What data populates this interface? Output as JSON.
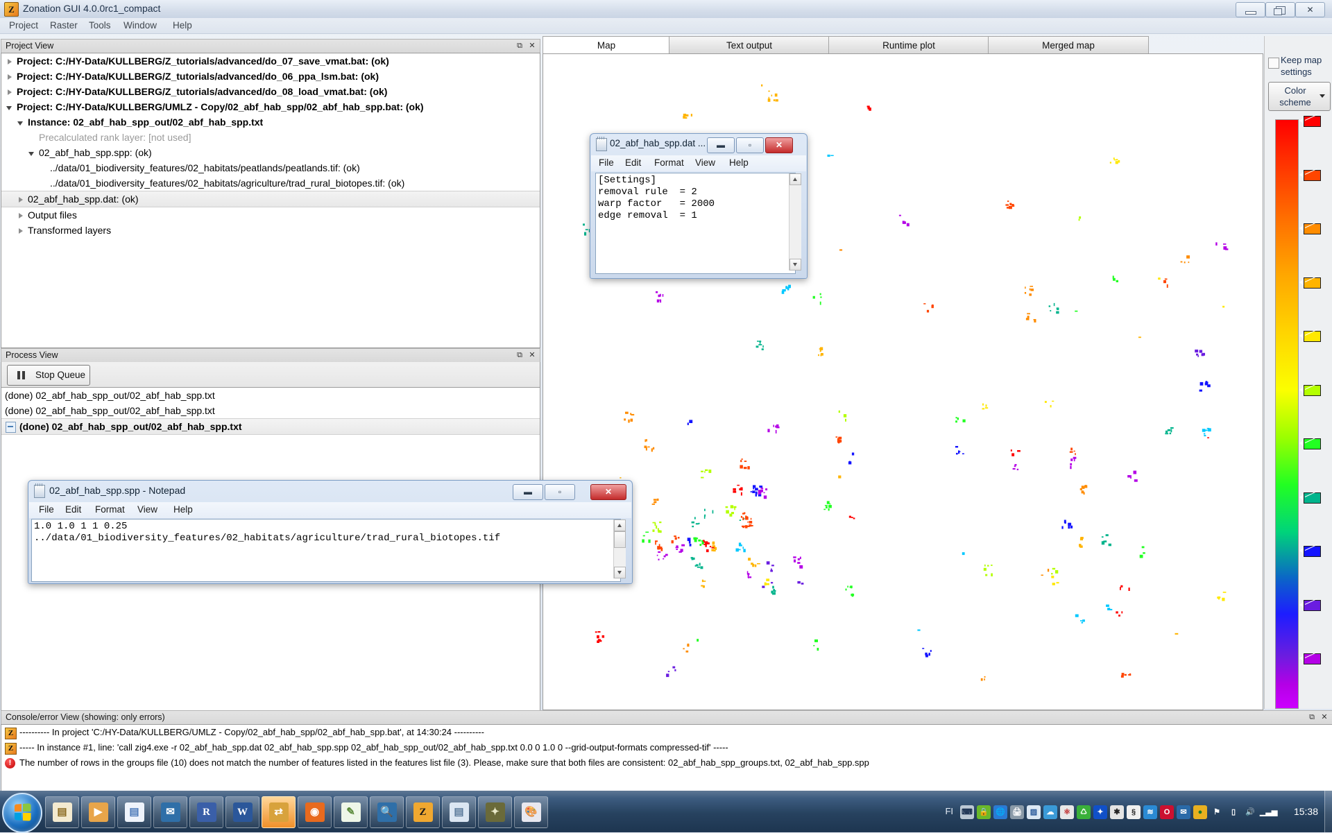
{
  "window": {
    "title": "Zonation GUI 4.0.0rc1_compact",
    "app_icon": "Z",
    "buttons": {
      "minimize": "minimize-icon",
      "maximize": "restore-icon",
      "close": "close-icon"
    }
  },
  "menubar": {
    "items": [
      "Project",
      "Raster",
      "Tools",
      "Window",
      "Help"
    ]
  },
  "project_view": {
    "title": "Project View",
    "float_label": "⧉",
    "close_label": "✕",
    "tree": [
      {
        "indent": 0,
        "twisty": "closed",
        "bold": true,
        "grey": false,
        "selected": false,
        "text": "Project: C:/HY-Data/KULLBERG/Z_tutorials/advanced/do_07_save_vmat.bat: (ok)"
      },
      {
        "indent": 0,
        "twisty": "closed",
        "bold": true,
        "grey": false,
        "selected": false,
        "text": "Project: C:/HY-Data/KULLBERG/Z_tutorials/advanced/do_06_ppa_lsm.bat: (ok)"
      },
      {
        "indent": 0,
        "twisty": "closed",
        "bold": true,
        "grey": false,
        "selected": false,
        "text": "Project: C:/HY-Data/KULLBERG/Z_tutorials/advanced/do_08_load_vmat.bat: (ok)"
      },
      {
        "indent": 0,
        "twisty": "open",
        "bold": true,
        "grey": false,
        "selected": false,
        "text": "Project: C:/HY-Data/KULLBERG/UMLZ - Copy/02_abf_hab_spp/02_abf_hab_spp.bat: (ok)"
      },
      {
        "indent": 1,
        "twisty": "open",
        "bold": true,
        "grey": false,
        "selected": false,
        "text": "Instance: 02_abf_hab_spp_out/02_abf_hab_spp.txt"
      },
      {
        "indent": 2,
        "twisty": "none",
        "bold": false,
        "grey": true,
        "selected": false,
        "text": "Precalculated rank layer: [not used]"
      },
      {
        "indent": 2,
        "twisty": "open",
        "bold": false,
        "grey": false,
        "selected": false,
        "text": "02_abf_hab_spp.spp: (ok)"
      },
      {
        "indent": 3,
        "twisty": "none",
        "bold": false,
        "grey": false,
        "selected": false,
        "text": "../data/01_biodiversity_features/02_habitats/peatlands/peatlands.tif: (ok)"
      },
      {
        "indent": 3,
        "twisty": "none",
        "bold": false,
        "grey": false,
        "selected": false,
        "text": "../data/01_biodiversity_features/02_habitats/agriculture/trad_rural_biotopes.tif: (ok)"
      },
      {
        "indent": 1,
        "twisty": "closed",
        "bold": false,
        "grey": false,
        "selected": true,
        "text": "02_abf_hab_spp.dat: (ok)"
      },
      {
        "indent": 1,
        "twisty": "closed",
        "bold": false,
        "grey": false,
        "selected": false,
        "text": "Output files"
      },
      {
        "indent": 1,
        "twisty": "closed",
        "bold": false,
        "grey": false,
        "selected": false,
        "text": "Transformed layers"
      }
    ]
  },
  "process_view": {
    "title": "Process View",
    "float_label": "⧉",
    "close_label": "✕",
    "stop_queue_label": "Stop Queue",
    "rows": [
      {
        "text": "(done) 02_abf_hab_spp_out/02_abf_hab_spp.txt",
        "selected": false
      },
      {
        "text": "(done) 02_abf_hab_spp_out/02_abf_hab_spp.txt",
        "selected": false
      },
      {
        "text": "(done) 02_abf_hab_spp_out/02_abf_hab_spp.txt",
        "selected": true
      }
    ]
  },
  "map_area": {
    "tabs": [
      {
        "label": "Map",
        "active": true
      },
      {
        "label": "Text output",
        "active": false
      },
      {
        "label": "Runtime plot",
        "active": false
      },
      {
        "label": "Merged map",
        "active": false
      }
    ],
    "keep_map_settings_label": "Keep map settings",
    "keep_map_settings_checked": false,
    "color_scheme_label": "Color scheme",
    "colorbar_stops": [
      "#ff0000",
      "#ff4500",
      "#ff8c00",
      "#ffb400",
      "#ffe800",
      "#b4ff00",
      "#22ff22",
      "#00b48c",
      "#1414ff",
      "#6a1de0",
      "#b400e6"
    ]
  },
  "console_view": {
    "title": "Console/error View (showing: only errors)",
    "float_label": "⧉",
    "close_label": "✕",
    "rows": [
      {
        "icon": "zonation-icon",
        "text": "---------- In project 'C:/HY-Data/KULLBERG/UMLZ - Copy/02_abf_hab_spp/02_abf_hab_spp.bat', at 14:30:24 ----------"
      },
      {
        "icon": "zonation-icon",
        "text": "----- In instance #1, line: 'call zig4.exe -r 02_abf_hab_spp.dat 02_abf_hab_spp.spp 02_abf_hab_spp_out/02_abf_hab_spp.txt 0.0 0 1.0 0  --grid-output-formats compressed-tif' -----"
      },
      {
        "icon": "error-icon",
        "text": "The number of rows in the groups file (10) does not match the number of features listed in the features list file (3). Please, make sure that both files are consistent: 02_abf_hab_spp_groups.txt, 02_abf_hab_spp.spp"
      }
    ]
  },
  "notepad_dat": {
    "title": "02_abf_hab_spp.dat ...",
    "menu": [
      "File",
      "Edit",
      "Format",
      "View",
      "Help"
    ],
    "content": "[Settings]\nremoval rule  = 2\nwarp factor   = 2000\nedge removal  = 1",
    "buttons": {
      "minimize": "minimize-icon",
      "maximize": "maximize-icon",
      "close": "close-icon"
    }
  },
  "notepad_spp": {
    "title": "02_abf_hab_spp.spp - Notepad",
    "menu": [
      "File",
      "Edit",
      "Format",
      "View",
      "Help"
    ],
    "content": "1.0 1.0 1 1 0.25\n../data/01_biodiversity_features/02_habitats/agriculture/trad_rural_biotopes.tif",
    "buttons": {
      "minimize": "minimize-icon",
      "maximize": "maximize-icon",
      "close": "close-icon"
    }
  },
  "taskbar": {
    "start_label": "start-orb",
    "buttons": [
      {
        "name": "explorer",
        "glyph": "▤",
        "bg": "#f3ead0",
        "color": "#8a6a20",
        "active": false
      },
      {
        "name": "media-player",
        "glyph": "▶",
        "bg": "#e8a54a",
        "color": "#fff",
        "active": false
      },
      {
        "name": "document",
        "glyph": "▤",
        "bg": "#eef3fb",
        "color": "#4a78b8",
        "active": false
      },
      {
        "name": "thunderbird",
        "glyph": "✉",
        "bg": "#2f6fa8",
        "color": "#fff",
        "active": false
      },
      {
        "name": "r-console",
        "glyph": "R",
        "bg": "#3a5fa8",
        "color": "#fff",
        "active": false
      },
      {
        "name": "word",
        "glyph": "W",
        "bg": "#2b579a",
        "color": "#fff",
        "active": false
      },
      {
        "name": "file-transfer",
        "glyph": "⇄",
        "bg": "#d8a23c",
        "color": "#fff",
        "active": true
      },
      {
        "name": "firefox",
        "glyph": "◉",
        "bg": "#e86a1e",
        "color": "#fff",
        "active": false
      },
      {
        "name": "notepad-edit",
        "glyph": "✎",
        "bg": "#eef6e8",
        "color": "#5a8a3a",
        "active": false
      },
      {
        "name": "search",
        "glyph": "🔍",
        "bg": "#2f6fa8",
        "color": "#fff",
        "active": false
      },
      {
        "name": "zonation",
        "glyph": "Z",
        "bg": "#f0a830",
        "color": "#1a1a1a",
        "active": false
      },
      {
        "name": "notepad",
        "glyph": "▤",
        "bg": "#dbe6f2",
        "color": "#5a7a9a",
        "active": false
      },
      {
        "name": "gimp",
        "glyph": "✦",
        "bg": "#6a6a3a",
        "color": "#e8e8c8",
        "active": false
      },
      {
        "name": "paint",
        "glyph": "🎨",
        "bg": "#e8e8f0",
        "color": "#b04a4a",
        "active": false
      }
    ],
    "tray": {
      "language": "FI",
      "icons": [
        {
          "name": "keyboard-icon",
          "glyph": "⌨",
          "bg": "#bcc8d4",
          "color": "#1a3050"
        },
        {
          "name": "security-icon",
          "glyph": "🔒",
          "bg": "#6ab82a",
          "color": "#fff"
        },
        {
          "name": "network-globe-icon",
          "glyph": "🌐",
          "bg": "#2a7ad4",
          "color": "#fff"
        },
        {
          "name": "printer-icon",
          "glyph": "🖨",
          "bg": "#8a9aa8",
          "color": "#fff"
        },
        {
          "name": "map-icon",
          "glyph": "▨",
          "bg": "#dce8f4",
          "color": "#2a5a9a"
        },
        {
          "name": "cloud-sync-icon",
          "glyph": "☁",
          "bg": "#3a9ad8",
          "color": "#fff"
        },
        {
          "name": "molecule-icon",
          "glyph": "⚛",
          "bg": "#e8e8e8",
          "color": "#c03030"
        },
        {
          "name": "recycle-icon",
          "glyph": "♺",
          "bg": "#3ab03a",
          "color": "#fff"
        },
        {
          "name": "bluetooth-icon",
          "glyph": "✦",
          "bg": "#1050c8",
          "color": "#fff"
        },
        {
          "name": "cursor-icon",
          "glyph": "✱",
          "bg": "#e4e4e4",
          "color": "#222"
        },
        {
          "name": "paragraph-icon",
          "glyph": "§",
          "bg": "#f0f0f0",
          "color": "#222"
        },
        {
          "name": "wifi-icon",
          "glyph": "≋",
          "bg": "#2a8ad4",
          "color": "#fff"
        },
        {
          "name": "opera-icon",
          "glyph": "O",
          "bg": "#cc1030",
          "color": "#fff"
        },
        {
          "name": "mail-icon",
          "glyph": "✉",
          "bg": "#2a6aa8",
          "color": "#fff"
        },
        {
          "name": "user-icon",
          "glyph": "●",
          "bg": "#e8b020",
          "color": "#1a7a2a"
        },
        {
          "name": "flag-icon",
          "glyph": "⚑",
          "bg": "transparent",
          "color": "#ffffff"
        },
        {
          "name": "battery-icon",
          "glyph": "▯",
          "bg": "transparent",
          "color": "#ffffff"
        },
        {
          "name": "volume-icon",
          "glyph": "🔊",
          "bg": "transparent",
          "color": "#ffffff"
        },
        {
          "name": "signal-icon",
          "glyph": "▁▃▅",
          "bg": "transparent",
          "color": "#ffffff"
        }
      ],
      "clock": "15:38"
    }
  }
}
